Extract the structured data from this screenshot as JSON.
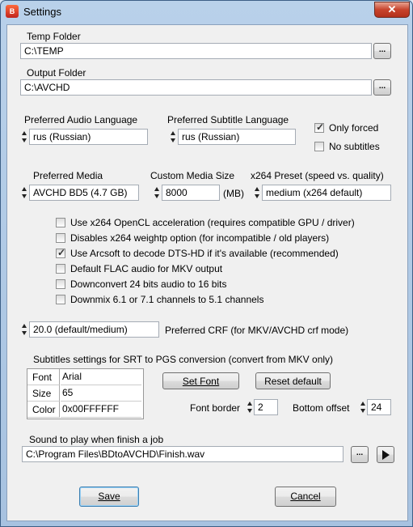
{
  "window": {
    "title": "Settings",
    "icon": "app-icon",
    "close_label": "✕"
  },
  "folders": {
    "temp_label": "Temp Folder",
    "temp_value": "C:\\TEMP",
    "output_label": "Output Folder",
    "output_value": "C:\\AVCHD",
    "browse_label": "..."
  },
  "audio": {
    "label": "Preferred Audio Language",
    "value": "rus (Russian)"
  },
  "subtitle": {
    "label": "Preferred Subtitle Language",
    "value": "rus (Russian)"
  },
  "subtitle_options": {
    "only_forced": {
      "label": "Only forced",
      "checked": true
    },
    "no_subtitles": {
      "label": "No subtitles",
      "checked": false
    }
  },
  "media": {
    "label": "Preferred Media",
    "value": "AVCHD BD5 (4.7 GB)"
  },
  "custom_media": {
    "label": "Custom Media Size",
    "value": "8000",
    "unit": "(MB)"
  },
  "x264": {
    "label": "x264 Preset (speed vs. quality)",
    "value": "medium (x264 default)"
  },
  "options": [
    {
      "label": "Use x264 OpenCL acceleration (requires compatible GPU / driver)",
      "checked": false
    },
    {
      "label": "Disables x264 weightp option (for incompatible / old players)",
      "checked": false
    },
    {
      "label": "Use Arcsoft to decode DTS-HD if it's available (recommended)",
      "checked": true
    },
    {
      "label": "Default FLAC audio for MKV output",
      "checked": false
    },
    {
      "label": "Downconvert 24 bits audio to 16 bits",
      "checked": false
    },
    {
      "label": "Downmix 6.1 or 7.1 channels to 5.1 channels",
      "checked": false
    }
  ],
  "crf": {
    "value": "20.0 (default/medium)",
    "label": "Preferred CRF (for MKV/AVCHD crf mode)"
  },
  "srt": {
    "section_label": "Subtitles settings for SRT to PGS conversion (convert from MKV only)",
    "rows": [
      {
        "key": "Font",
        "value": "Arial"
      },
      {
        "key": "Size",
        "value": "65"
      },
      {
        "key": "Color",
        "value": "0x00FFFFFF"
      }
    ],
    "set_font_label": "Set Font",
    "reset_label": "Reset default",
    "font_border_label": "Font border",
    "font_border_value": "2",
    "bottom_offset_label": "Bottom offset",
    "bottom_offset_value": "24"
  },
  "sound": {
    "label": "Sound to play when finish a job",
    "value": "C:\\Program Files\\BDtoAVCHD\\Finish.wav"
  },
  "buttons": {
    "save": "Save",
    "cancel": "Cancel"
  }
}
